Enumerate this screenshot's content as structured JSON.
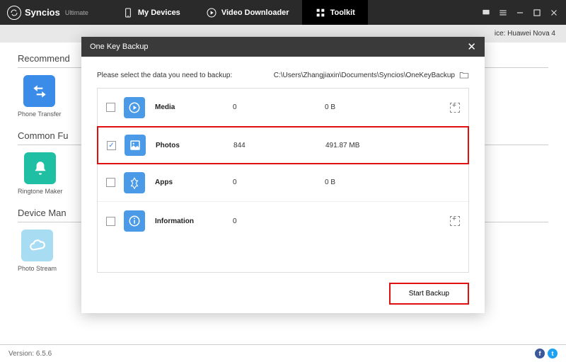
{
  "app": {
    "name": "Syncios",
    "edition": "Ultimate"
  },
  "nav": {
    "devices": "My Devices",
    "downloader": "Video Downloader",
    "toolkit": "Toolkit"
  },
  "device_label": "ice: Huawei Nova 4",
  "sections": {
    "recommended": {
      "title": "Recommend",
      "items": [
        {
          "label": "Phone Transfer"
        }
      ]
    },
    "common": {
      "title": "Common Fu",
      "items": [
        {
          "label": "Ringtone Maker"
        }
      ]
    },
    "device": {
      "title": "Device Man",
      "items": [
        {
          "label": "Photo Stream"
        }
      ]
    }
  },
  "modal": {
    "title": "One Key Backup",
    "prompt": "Please select the data you need to backup:",
    "path": "C:\\Users\\Zhangjiaxin\\Documents\\Syncios\\OneKeyBackup",
    "rows": [
      {
        "name": "Media",
        "count": "0",
        "size": "0 B",
        "checked": false,
        "expandable": true
      },
      {
        "name": "Photos",
        "count": "844",
        "size": "491.87 MB",
        "checked": true,
        "expandable": false
      },
      {
        "name": "Apps",
        "count": "0",
        "size": "0 B",
        "checked": false,
        "expandable": false
      },
      {
        "name": "Information",
        "count": "0",
        "size": "",
        "checked": false,
        "expandable": true
      }
    ],
    "start_button": "Start Backup"
  },
  "version": "Version: 6.5.6"
}
